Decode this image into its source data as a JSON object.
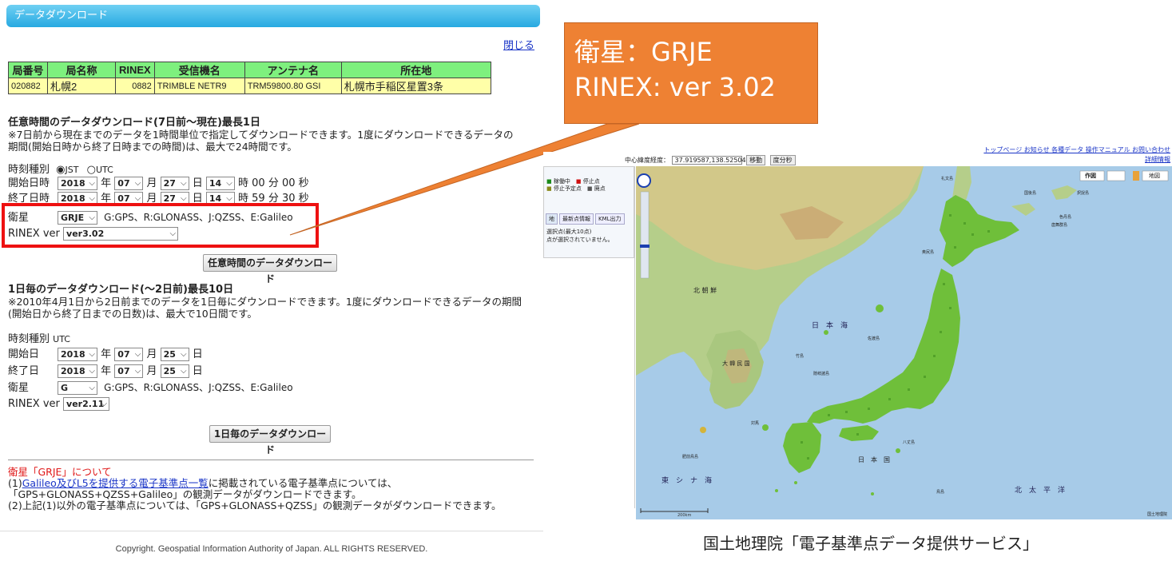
{
  "left": {
    "title": "データダウンロード",
    "close_label": "閉じる",
    "station_table": {
      "headers": [
        "局番号",
        "局名称",
        "RINEX",
        "受信機名",
        "アンテナ名",
        "所在地"
      ],
      "row": [
        "020882",
        "札幌2",
        "0882",
        "TRIMBLE NETR9",
        "TRM59800.80 GSI",
        "札幌市手稲区星置3条"
      ]
    },
    "section1": {
      "heading": "任意時間のデータダウンロード(7日前～現在)最長1日",
      "desc1": "※7日前から現在までのデータを1時間単位で指定してダウンロードできます。1度にダウンロードできるデータの",
      "desc2": "期間(開始日時から終了日時までの時間)は、最大で24時間です。",
      "time_type_label": "時刻種別",
      "jst_label": "JST",
      "utc_label": "UTC",
      "start_label": "開始日時",
      "end_label": "終了日時",
      "start": {
        "year": "2018",
        "month": "07",
        "day": "27",
        "hour": "14",
        "min_sec": "時 00 分 00 秒"
      },
      "end": {
        "year": "2018",
        "month": "07",
        "day": "27",
        "hour": "14",
        "min_sec": "時 59 分 30 秒"
      },
      "year_unit": "年",
      "month_unit": "月",
      "day_unit": "日",
      "sat_label": "衛星",
      "sat_value": "GRJE",
      "sat_note": "G:GPS、R:GLONASS、J:QZSS、E:Galileo",
      "rinex_label": "RINEX ver",
      "rinex_value": "ver3.02",
      "button": "任意時間のデータダウンロード"
    },
    "section2": {
      "heading": "1日毎のデータダウンロード(～2日前)最長10日",
      "desc1": "※2010年4月1日から2日前までのデータを1日毎にダウンロードできます。1度にダウンロードできるデータの期間",
      "desc2": "(開始日から終了日までの日数)は、最大で10日間です。",
      "time_type_label": "時刻種別",
      "time_type_value": "UTC",
      "start_label": "開始日",
      "end_label": "終了日",
      "start": {
        "year": "2018",
        "month": "07",
        "day": "25"
      },
      "end": {
        "year": "2018",
        "month": "07",
        "day": "25"
      },
      "sat_label": "衛星",
      "sat_value": "G",
      "sat_note": "G:GPS、R:GLONASS、J:QZSS、E:Galileo",
      "rinex_label": "RINEX ver",
      "rinex_value": "ver2.11",
      "button": "1日毎のデータダウンロード"
    },
    "notes": {
      "title": "衛星「GRJE」について",
      "l1_pre": "(1)",
      "l1_link": "Galileo及びL5を提供する電子基準点一覧",
      "l1_post": "に掲載されている電子基準点については、",
      "l2": "「GPS+GLONASS+QZSS+Galileo」の観測データがダウンロードできます。",
      "l3": "(2)上記(1)以外の電子基準点については、「GPS+GLONASS+QZSS」の観測データがダウンロードできます。"
    },
    "footer": "Copyright. Geospatial Information Authority of Japan. ALL RIGHTS RESERVED."
  },
  "callout": {
    "line1": "衛星：GRJE",
    "line2": "RINEX: ver 3.02",
    "color": "#ee8133"
  },
  "map_window": {
    "top_links": "トップページ お知らせ 各種データ 操作マニュアル お問い合わせ",
    "detail_link": "詳細情報",
    "coord_label": "中心緯度経度：",
    "coord_value": "37.919587,138.525042",
    "move_btn": "移動",
    "deg_btn": "度分秒",
    "tabs": [
      "地",
      "最新点情報",
      "KML出力"
    ],
    "legend": [
      "稼働中",
      "停止点",
      "停止予定点",
      "廃点"
    ],
    "panel_text1": "選択点(最大10点)",
    "panel_text2": "点が選択されていません。",
    "tool_buttons": [
      "作図",
      "地図"
    ],
    "scale_label": "200km",
    "map_labels": {
      "sea_japan": "日　本　海",
      "east_china": "東　シ　ナ　海",
      "pacific": "北　太　平　洋",
      "korea_north": "北 朝 鮮",
      "korea_south": "大 韓 民 国",
      "japan": "日　本　国",
      "etorofu": "択捉島",
      "kunashiri": "国後島",
      "shikotan": "色丹島",
      "habomai": "歯舞群島",
      "rebun": "礼文島",
      "okushiri": "奥尻島",
      "sado": "佐渡島",
      "oki": "隠岐諸島",
      "takeshima": "竹島",
      "tsushima": "対馬",
      "hachijo": "八丈島",
      "tokara": "肥前鳥島",
      "torishima": "鳥島",
      "gsi": "国土地理院"
    }
  },
  "caption": "国土地理院「電子基準点データ提供サービス」"
}
